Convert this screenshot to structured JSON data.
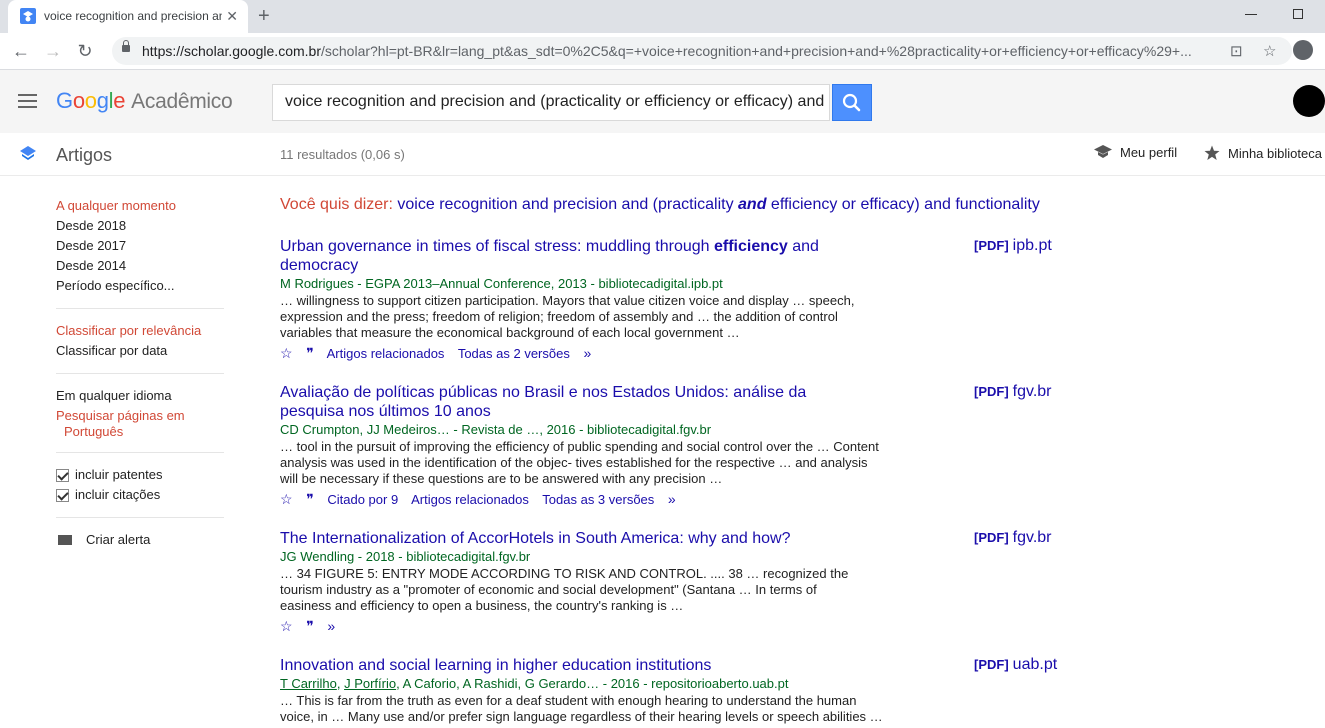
{
  "browser": {
    "tab_title": "voice recognition and precision and",
    "url_host": "https://scholar.google.com.br",
    "url_path": "/scholar?hl=pt-BR&lr=lang_pt&as_sdt=0%2C5&q=+voice+recognition+and+precision+and+%28practicality+or+efficiency+or+efficacy%29+..."
  },
  "header": {
    "logo_google": "Google",
    "logo_product": "Acadêmico",
    "search_value": "voice recognition and precision and (practicality or efficiency or efficacy) and"
  },
  "subbar": {
    "section": "Artigos",
    "results_count": "11 resultados (0,06 s)",
    "my_profile": "Meu perfil",
    "my_library": "Minha biblioteca"
  },
  "sidebar": {
    "time": [
      "A qualquer momento",
      "Desde 2018",
      "Desde 2017",
      "Desde 2014",
      "Período específico..."
    ],
    "sort": [
      "Classificar por relevância",
      "Classificar por data"
    ],
    "lang_any": "Em qualquer idioma",
    "lang_pt_1": "Pesquisar páginas em",
    "lang_pt_2": "Português",
    "include_patents": "incluir patentes",
    "include_citations": "incluir citações",
    "create_alert": "Criar alerta"
  },
  "did_you_mean": {
    "prefix": "Você quis dizer:",
    "part1": "voice recognition and precision and (practicality ",
    "bold": "and",
    "part2": " efficiency or efficacy) and functionality"
  },
  "results": [
    {
      "title_line1_a": "Urban governance in times of fiscal stress: muddling through ",
      "title_line1_b": "efficiency",
      "title_line1_c": " and",
      "title_line2": "democracy",
      "authors": "M Rodrigues - EGPA 2013–Annual Conference, 2013 - bibliotecadigital.ipb.pt",
      "snippet1": "… willingness to support citizen participation. Mayors that value citizen voice and display … speech,",
      "snippet2": "expression and the press; freedom of religion; freedom of assembly and … the addition of control",
      "snippet3": "variables that measure the economical background of each local government …",
      "related": "Artigos relacionados",
      "versions": "Todas as 2 versões",
      "pdf_tag": "[PDF]",
      "pdf_host": "ipb.pt"
    },
    {
      "title_line1": "Avaliação de políticas públicas no Brasil e nos Estados Unidos: análise da",
      "title_line2": "pesquisa nos últimos 10 anos",
      "authors": "CD Crumpton, JJ Medeiros… - Revista de …, 2016 - bibliotecadigital.fgv.br",
      "snippet1": "… tool in the pursuit of improving the efficiency of public spending and social control over the … Content",
      "snippet2": "analysis was used in the identification of the objec- tives established for the respective … and analysis",
      "snippet3": "will be necessary if these questions are to be answered with any precision …",
      "cited": "Citado por 9",
      "related": "Artigos relacionados",
      "versions": "Todas as 3 versões",
      "pdf_tag": "[PDF]",
      "pdf_host": "fgv.br"
    },
    {
      "title_line1": "The Internationalization of AccorHotels in South America: why and how?",
      "authors": "JG Wendling - 2018 - bibliotecadigital.fgv.br",
      "snippet1": "… 34 FIGURE 5: ENTRY MODE ACCORDING TO RISK AND CONTROL. .... 38 … recognized the",
      "snippet2": "tourism industry as a \"promoter of economic and social development\" (Santana … In terms of",
      "snippet3": "easiness and efficiency to open a business, the country's ranking is …",
      "pdf_tag": "[PDF]",
      "pdf_host": "fgv.br"
    },
    {
      "title_line1": "Innovation and social learning in higher education institutions",
      "author1": "T Carrilho",
      "author2": "J Porfírio",
      "authors_rest": ", A Caforio, A Rashidi, G Gerardo… - 2016 - repositorioaberto.uab.pt",
      "snippet1": "… This is far from the truth as even for a deaf student with enough hearing to understand the human",
      "snippet2": "voice, in … Many use and/or prefer sign language regardless of their hearing levels or speech abilities …",
      "pdf_tag": "[PDF]",
      "pdf_host": "uab.pt"
    }
  ]
}
